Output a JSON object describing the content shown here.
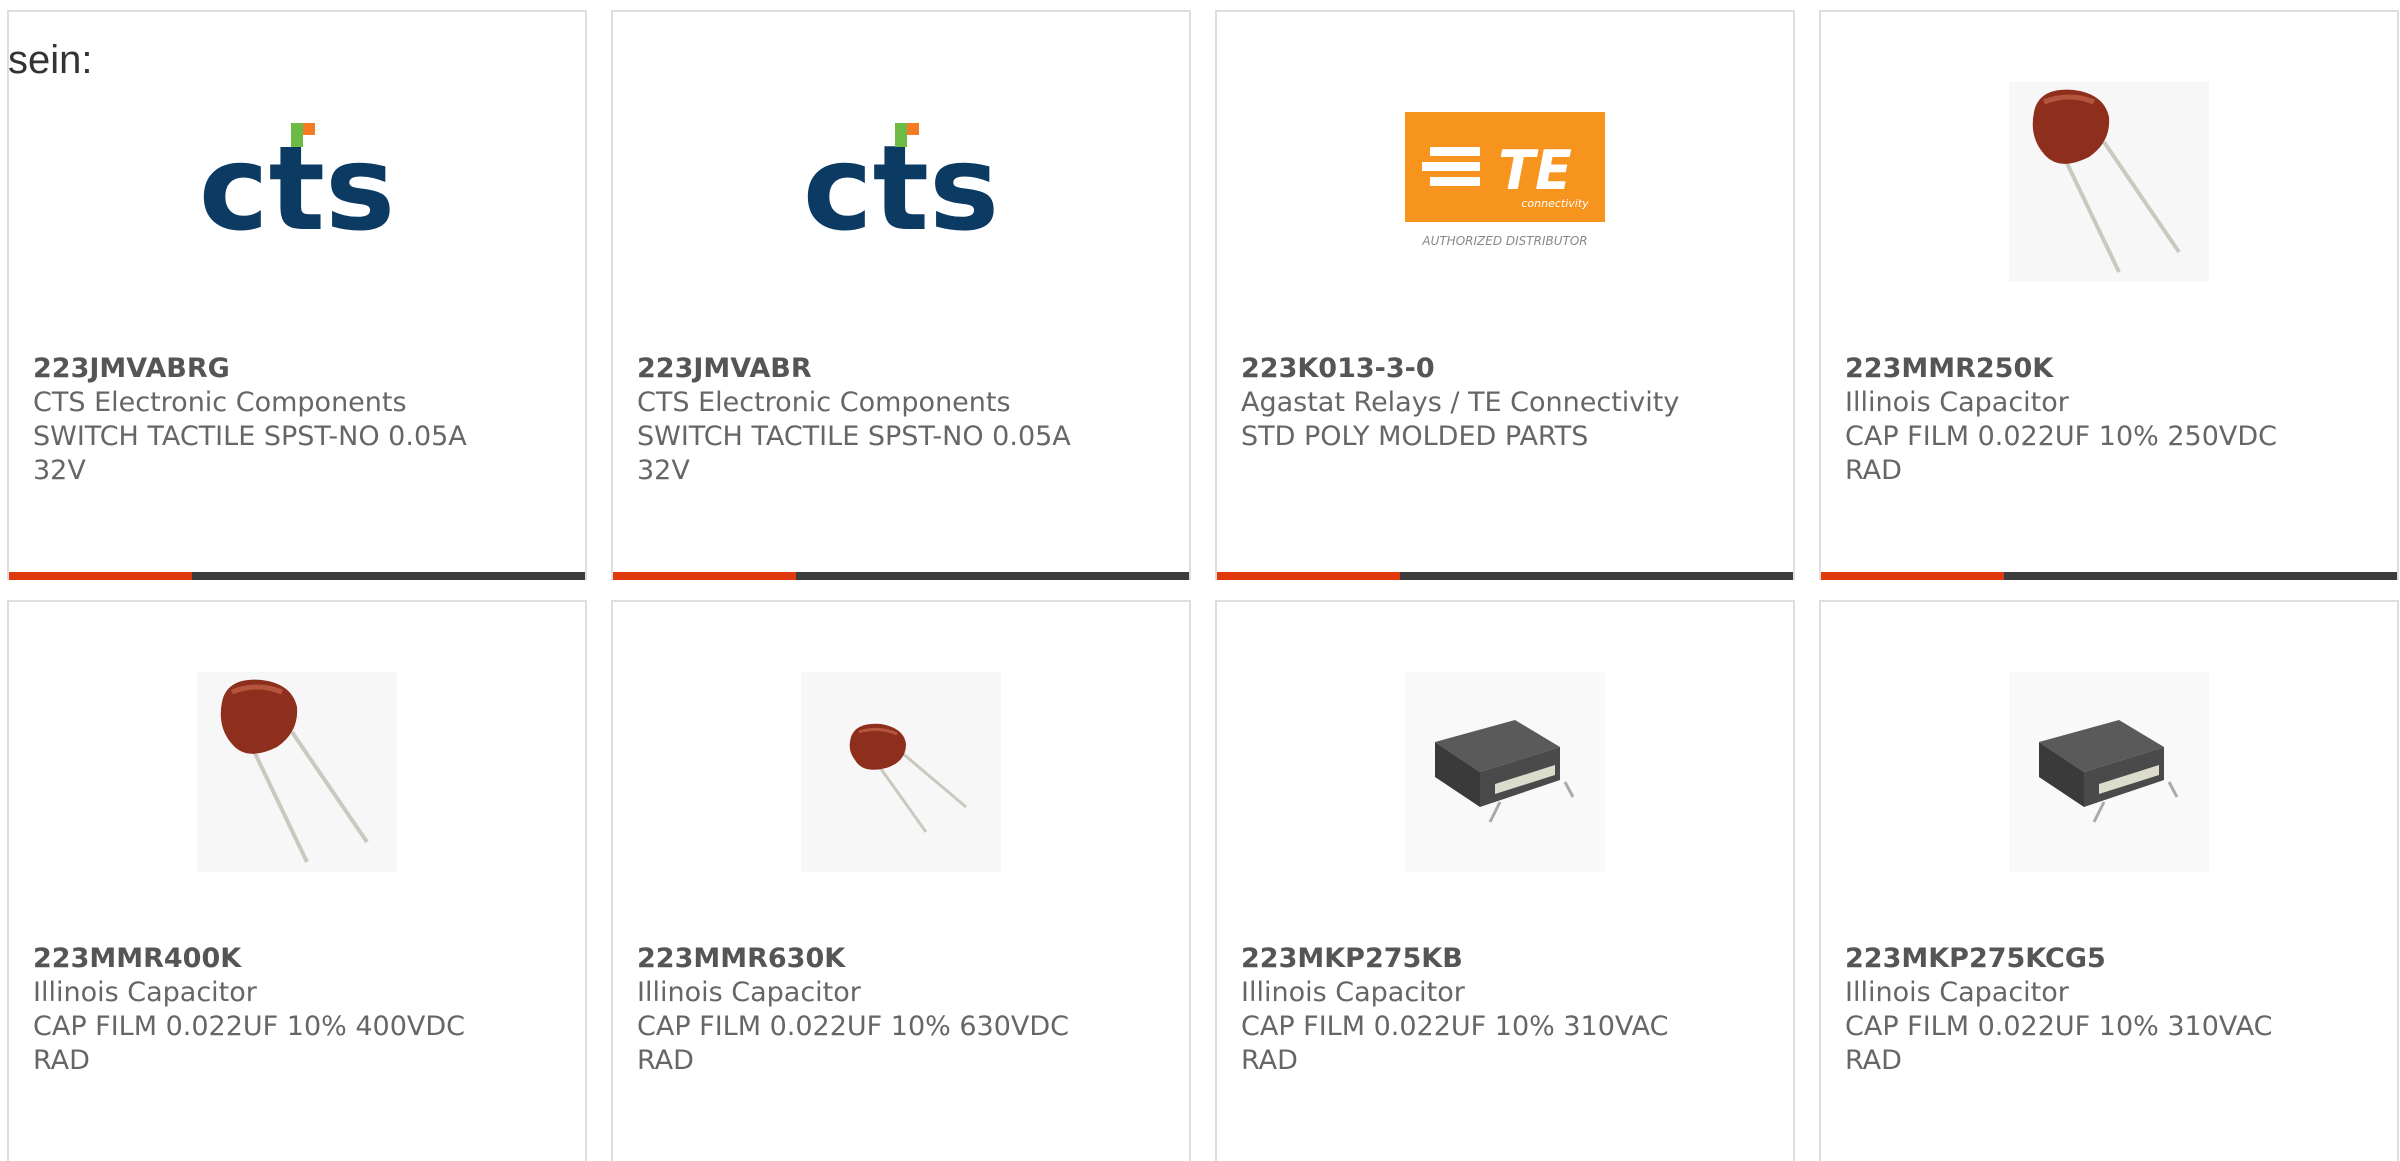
{
  "intro_text": "sein:",
  "colors": {
    "accent": "#e03a0c",
    "bar": "#3c3c3c",
    "border": "#dedede",
    "cts_blue": "#0b3a63",
    "cts_green": "#6dbb45",
    "cts_orange": "#f47b20",
    "te_orange": "#f7941d"
  },
  "products": [
    {
      "part_number": "223JMVABRG",
      "manufacturer": "CTS Electronic Components",
      "description": "SWITCH TACTILE SPST-NO 0.05A 32V",
      "image": "cts-logo"
    },
    {
      "part_number": "223JMVABR",
      "manufacturer": "CTS Electronic Components",
      "description": "SWITCH TACTILE SPST-NO 0.05A 32V",
      "image": "cts-logo"
    },
    {
      "part_number": "223K013-3-0",
      "manufacturer": "Agastat Relays / TE Connectivity",
      "description": "STD POLY MOLDED PARTS",
      "image": "te-connectivity-logo",
      "logo_text": {
        "brand": "TE",
        "sub": "connectivity",
        "caption": "AUTHORIZED DISTRIBUTOR"
      }
    },
    {
      "part_number": "223MMR250K",
      "manufacturer": "Illinois Capacitor",
      "description": "CAP FILM 0.022UF 10% 250VDC RAD",
      "image": "film-capacitor-red"
    },
    {
      "part_number": "223MMR400K",
      "manufacturer": "Illinois Capacitor",
      "description": "CAP FILM 0.022UF 10% 400VDC RAD",
      "image": "film-capacitor-red"
    },
    {
      "part_number": "223MMR630K",
      "manufacturer": "Illinois Capacitor",
      "description": "CAP FILM 0.022UF 10% 630VDC RAD",
      "image": "film-capacitor-red-small"
    },
    {
      "part_number": "223MKP275KB",
      "manufacturer": "Illinois Capacitor",
      "description": "CAP FILM 0.022UF 10% 310VAC RAD",
      "image": "box-capacitor-gray"
    },
    {
      "part_number": "223MKP275KCG5",
      "manufacturer": "Illinois Capacitor",
      "description": "CAP FILM 0.022UF 10% 310VAC RAD",
      "image": "box-capacitor-gray"
    }
  ]
}
